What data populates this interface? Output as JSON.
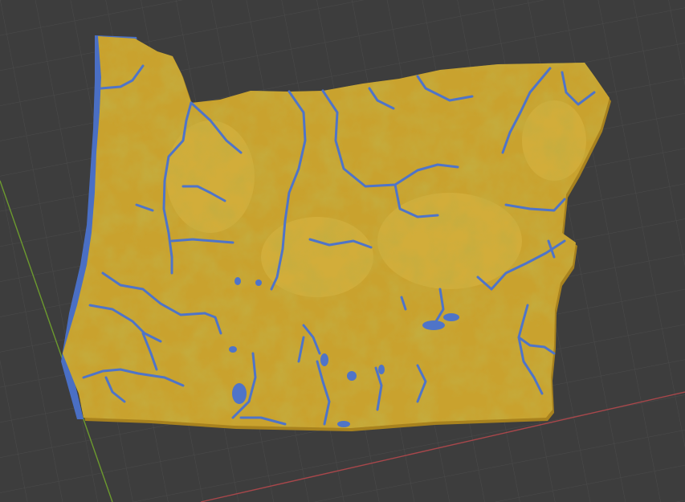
{
  "viewport": {
    "background_color": "#3d3d3d",
    "grid_color": "#4a4a4a",
    "x_axis_color": "#a8474b",
    "y_axis_color": "#6c9a2e"
  },
  "terrain": {
    "land_color": "#c9a22e",
    "land_shadow_color": "#a8821e",
    "highland_color": "#d8b645",
    "water_color": "#4f74c8",
    "coast_color": "#4a6fc4"
  }
}
